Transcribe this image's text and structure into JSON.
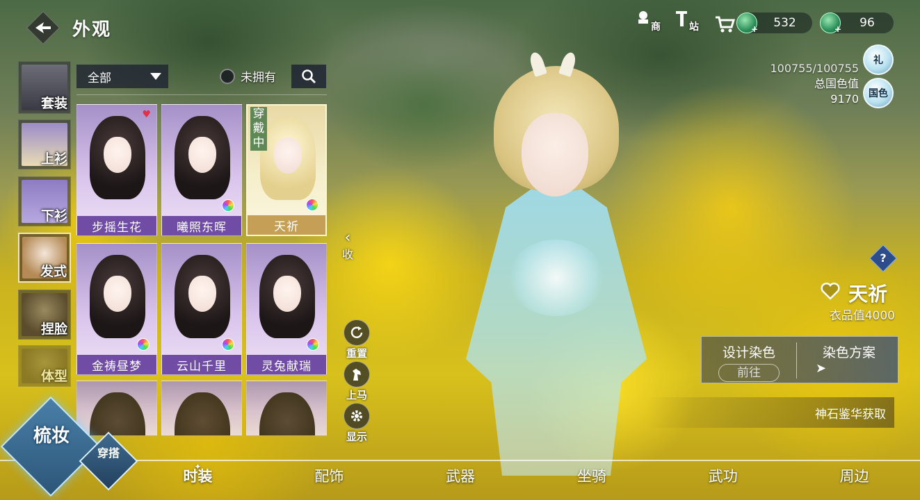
{
  "header": {
    "title": "外观",
    "back_icon": "back-arrow-icon"
  },
  "top_icons": [
    {
      "name": "mall-icon",
      "label": "商"
    },
    {
      "name": "station-icon",
      "label": "站"
    },
    {
      "name": "cart-icon",
      "label": ""
    }
  ],
  "currency": {
    "jade": {
      "icon": "jade-gem-icon",
      "amount": "532"
    },
    "gem": {
      "icon": "green-gem-icon",
      "amount": "96"
    }
  },
  "stats": {
    "collection": "100755/100755",
    "national_color_label": "总国色值",
    "national_color_value": "9170",
    "gift_badge": "礼",
    "guose_badge": "国色"
  },
  "categories": [
    {
      "label": "套装",
      "active": false
    },
    {
      "label": "上衫",
      "active": false
    },
    {
      "label": "下衫",
      "active": false
    },
    {
      "label": "发式",
      "active": true
    },
    {
      "label": "捏脸",
      "active": false
    },
    {
      "label": "体型",
      "active": false
    }
  ],
  "filter": {
    "selected": "全部",
    "unowned_label": "未拥有",
    "search_icon": "search-icon"
  },
  "items": [
    {
      "name": "步摇生花",
      "favorite": true,
      "dye": false
    },
    {
      "name": "曦照东晖",
      "favorite": false,
      "dye": true
    },
    {
      "name": "天祈",
      "favorite": false,
      "dye": true,
      "wearing": "穿戴中"
    },
    {
      "name": "金祷昼梦",
      "favorite": false,
      "dye": true
    },
    {
      "name": "云山千里",
      "favorite": false,
      "dye": true
    },
    {
      "name": "灵兔献瑞",
      "favorite": false,
      "dye": true
    }
  ],
  "actions": {
    "collapse": "收",
    "reset": "重置",
    "mount": "上马",
    "display": "显示"
  },
  "selected_item": {
    "name": "天祈",
    "value": "衣品值4000",
    "help": "?"
  },
  "dye": {
    "design_label": "设计染色",
    "goto_label": "前往",
    "plan_label": "染色方案"
  },
  "source": "神石鉴华获取",
  "modes": {
    "makeup": "梳妆",
    "outfit": "穿搭"
  },
  "bottom_nav": [
    {
      "label": "时装",
      "active": true
    },
    {
      "label": "配饰",
      "active": false
    },
    {
      "label": "武器",
      "active": false
    },
    {
      "label": "坐骑",
      "active": false
    },
    {
      "label": "武功",
      "active": false
    },
    {
      "label": "周边",
      "active": false
    }
  ]
}
